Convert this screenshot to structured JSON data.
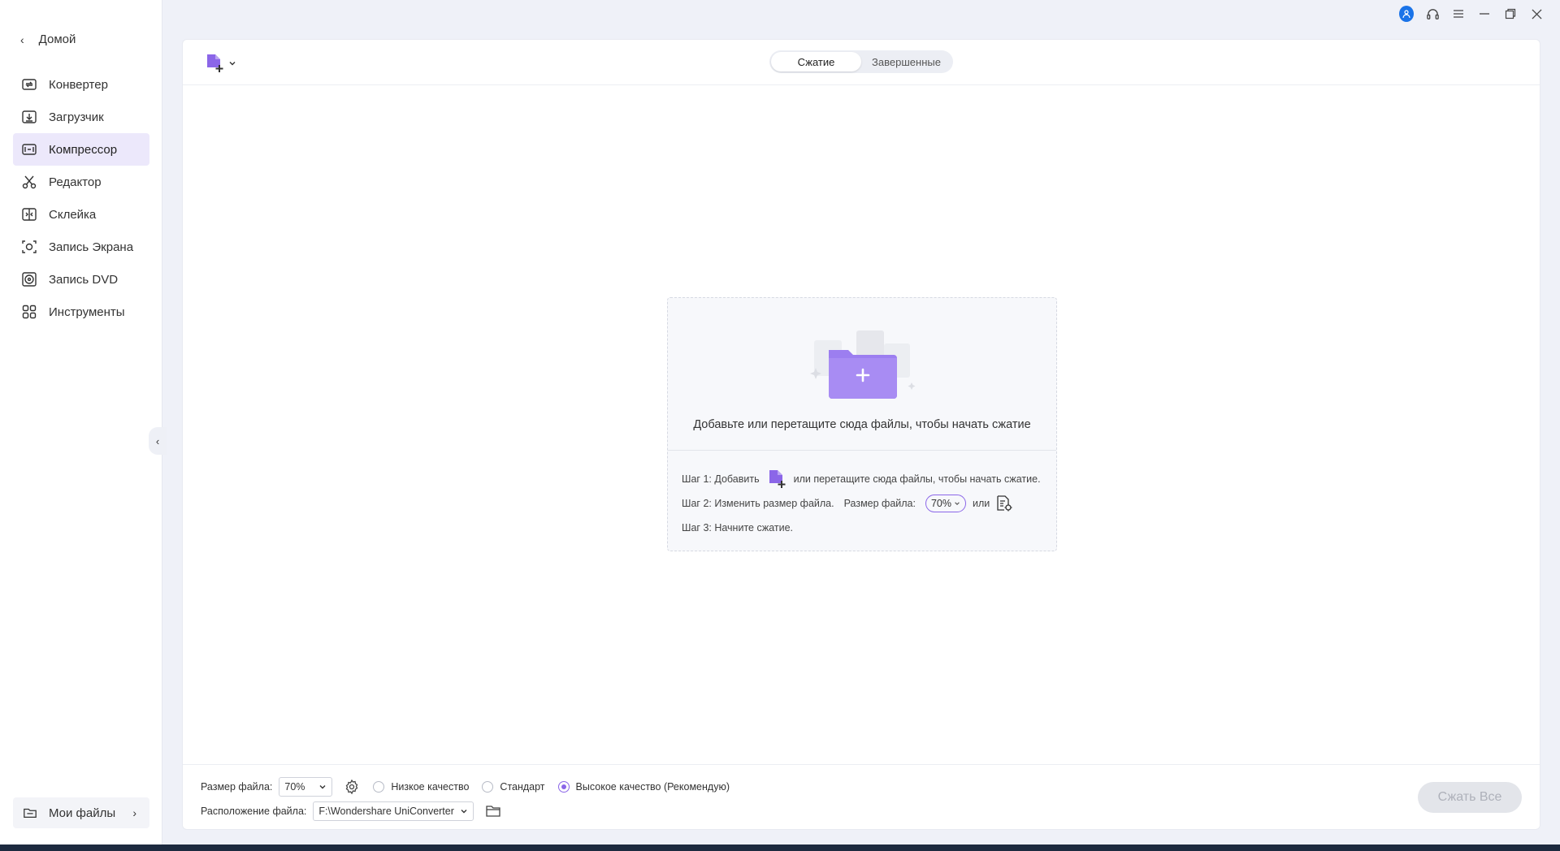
{
  "sidebar": {
    "home_label": "Домой",
    "items": [
      {
        "label": "Конвертер",
        "icon": "converter-icon"
      },
      {
        "label": "Загрузчик",
        "icon": "downloader-icon"
      },
      {
        "label": "Компрессор",
        "icon": "compressor-icon",
        "active": true
      },
      {
        "label": "Редактор",
        "icon": "scissors-icon"
      },
      {
        "label": "Склейка",
        "icon": "merger-icon"
      },
      {
        "label": "Запись Экрана",
        "icon": "screen-record-icon"
      },
      {
        "label": "Запись DVD",
        "icon": "dvd-icon"
      },
      {
        "label": "Инструменты",
        "icon": "toolbox-icon"
      }
    ],
    "my_files_label": "Мои файлы"
  },
  "tabs": {
    "compress": "Сжатие",
    "finished": "Завершенные"
  },
  "dropzone": {
    "text": "Добавьте или перетащите сюда файлы, чтобы начать сжатие",
    "step1_prefix": "Шаг 1: Добавить",
    "step1_suffix": "или перетащите сюда файлы, чтобы начать сжатие.",
    "step2_prefix": "Шаг 2: Изменить размер файла.",
    "step2_size_label": "Размер файла:",
    "step2_size_value": "70%",
    "step2_or": "или",
    "step3": "Шаг 3: Начните сжатие."
  },
  "bottom": {
    "file_size_label": "Размер файла:",
    "file_size_value": "70%",
    "quality_low": "Низкое качество",
    "quality_standard": "Стандарт",
    "quality_high": "Высокое качество (Рекомендую)",
    "location_label": "Расположение файла:",
    "location_value": "F:\\Wondershare UniConverter",
    "compress_all": "Сжать Все"
  },
  "colors": {
    "accent": "#8b66e8",
    "active_nav_bg": "#ece8fb",
    "user_badge": "#1a73e8"
  }
}
